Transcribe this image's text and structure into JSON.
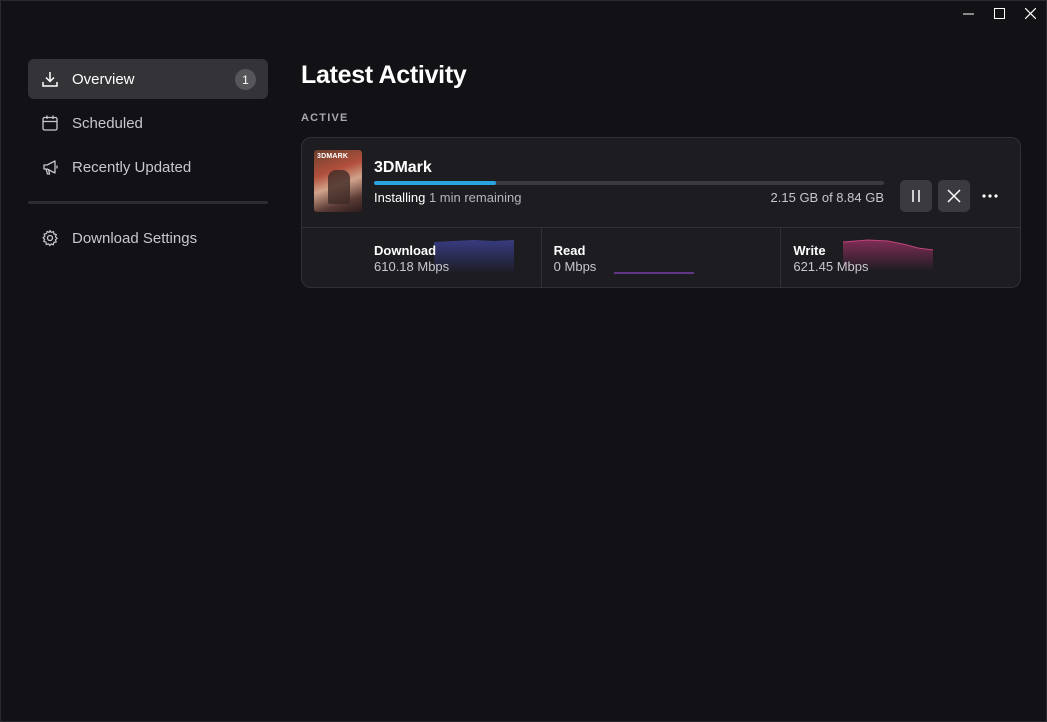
{
  "window": {
    "controls": [
      "minimize",
      "maximize",
      "close"
    ]
  },
  "sidebar": {
    "items": [
      {
        "label": "Overview",
        "icon": "download-icon",
        "badge": "1",
        "active": true
      },
      {
        "label": "Scheduled",
        "icon": "calendar-icon"
      },
      {
        "label": "Recently Updated",
        "icon": "megaphone-icon"
      }
    ],
    "settings": {
      "label": "Download Settings",
      "icon": "gear-icon"
    }
  },
  "main": {
    "title": "Latest Activity",
    "section_label": "ACTIVE",
    "active_download": {
      "thumbnail_brand": "3DMARK",
      "title": "3DMark",
      "status": "Installing",
      "remaining": "1 min remaining",
      "size": "2.15 GB of 8.84 GB",
      "progress": 0.24,
      "stats": [
        {
          "label": "Download",
          "value": "610.18 Mbps",
          "color": "#3b3f8a"
        },
        {
          "label": "Read",
          "value": "0 Mbps",
          "color": "#7a3fa8"
        },
        {
          "label": "Write",
          "value": "621.45 Mbps",
          "color": "#8a2f5c"
        }
      ]
    }
  },
  "colors": {
    "accent": "#2aa4e0",
    "background": "#121216",
    "card": "#1c1c21"
  }
}
